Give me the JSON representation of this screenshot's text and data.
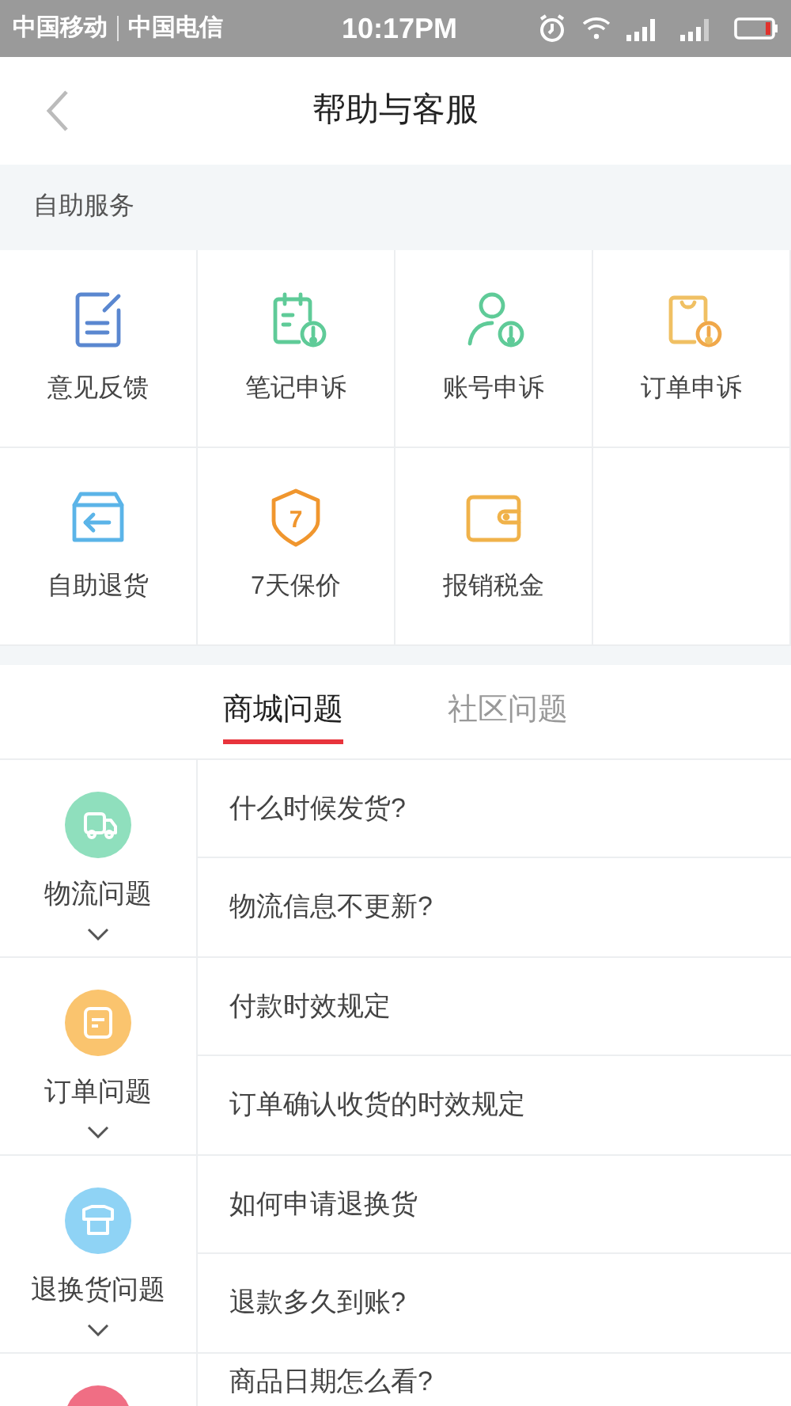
{
  "status_bar": {
    "carriers": [
      "中国移动",
      "中国电信"
    ],
    "time": "10:17PM"
  },
  "header": {
    "title": "帮助与客服"
  },
  "section_label": "自助服务",
  "services": [
    {
      "label": "意见反馈",
      "kind": "feedback"
    },
    {
      "label": "笔记申诉",
      "kind": "note"
    },
    {
      "label": "账号申诉",
      "kind": "account"
    },
    {
      "label": "订单申诉",
      "kind": "order"
    },
    {
      "label": "自助退货",
      "kind": "return"
    },
    {
      "label": "7天保价",
      "kind": "price",
      "badge": "7"
    },
    {
      "label": "报销税金",
      "kind": "tax"
    }
  ],
  "tabs": [
    {
      "label": "商城问题",
      "selected": true
    },
    {
      "label": "社区问题",
      "selected": false
    }
  ],
  "categories": [
    {
      "label": "物流问题",
      "kind": "truck",
      "color": "#8fdfbd",
      "questions": [
        "什么时候发货?",
        "物流信息不更新?"
      ]
    },
    {
      "label": "订单问题",
      "kind": "order",
      "color": "#fac46e",
      "questions": [
        "付款时效规定",
        "订单确认收货的时效规定"
      ]
    },
    {
      "label": "退换货问题",
      "kind": "shirt",
      "color": "#8fd3f5",
      "questions": [
        "如何申请退换货",
        "退款多久到账?"
      ]
    },
    {
      "kind": "other",
      "color": "#f06e84",
      "questions": [
        "商品日期怎么看?"
      ]
    }
  ]
}
